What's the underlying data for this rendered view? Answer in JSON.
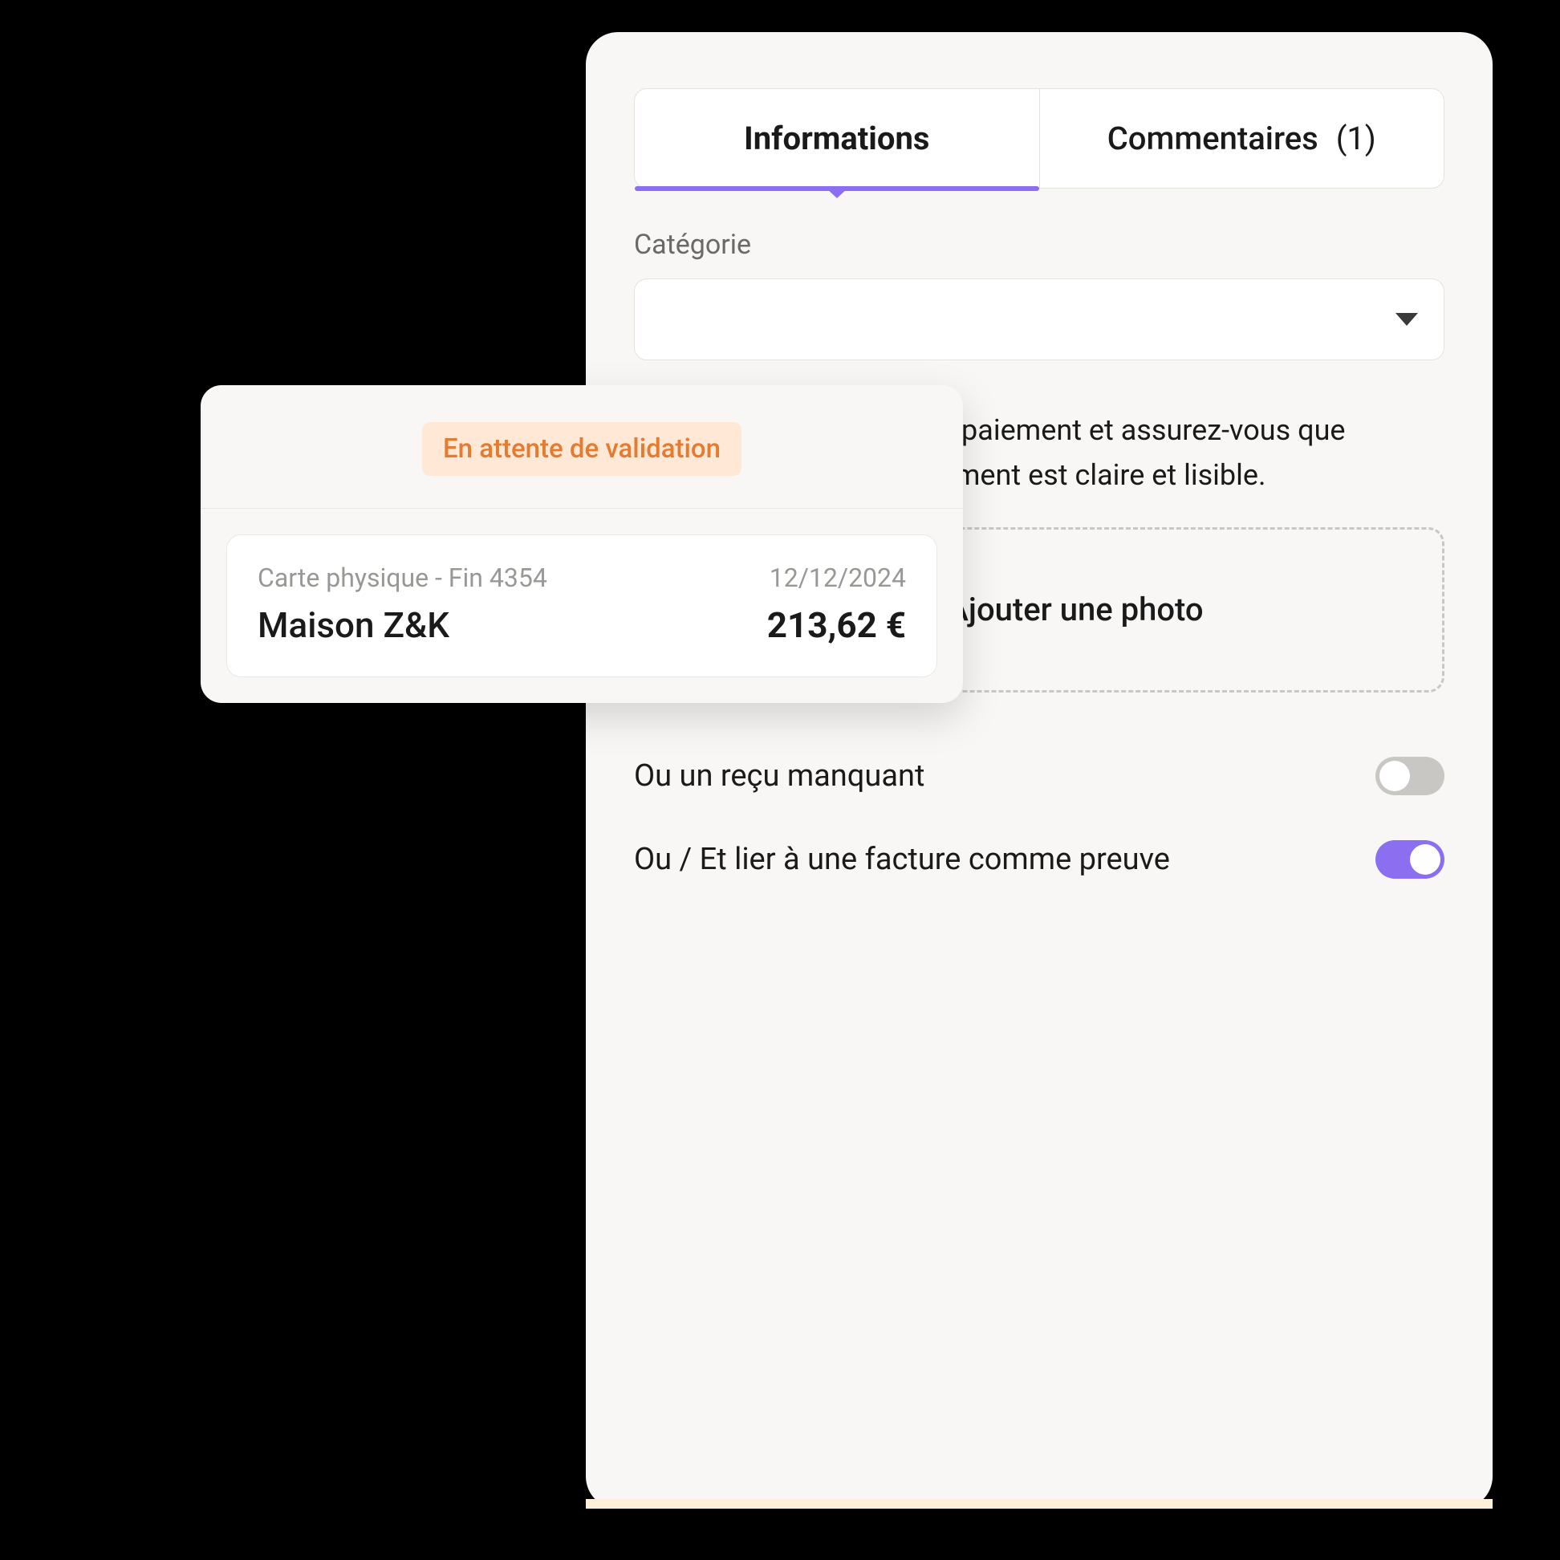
{
  "tabs": {
    "info_label": "Informations",
    "comments_label": "Commentaires",
    "comments_count": "(1)"
  },
  "category": {
    "label": "Catégorie"
  },
  "helper": {
    "line1": "e paiement et assurez-vous que",
    "line2": "ument est claire et lisible."
  },
  "upload": {
    "label": "Ajouter une photo"
  },
  "toggles": {
    "missing_receipt_label": "Ou un reçu manquant",
    "link_invoice_label": "Ou / Et lier à une facture comme preuve"
  },
  "card": {
    "status": "En attente de validation",
    "card_meta": "Carte physique - Fin 4354",
    "date": "12/12/2024",
    "merchant": "Maison Z&K",
    "amount": "213,62 €"
  }
}
